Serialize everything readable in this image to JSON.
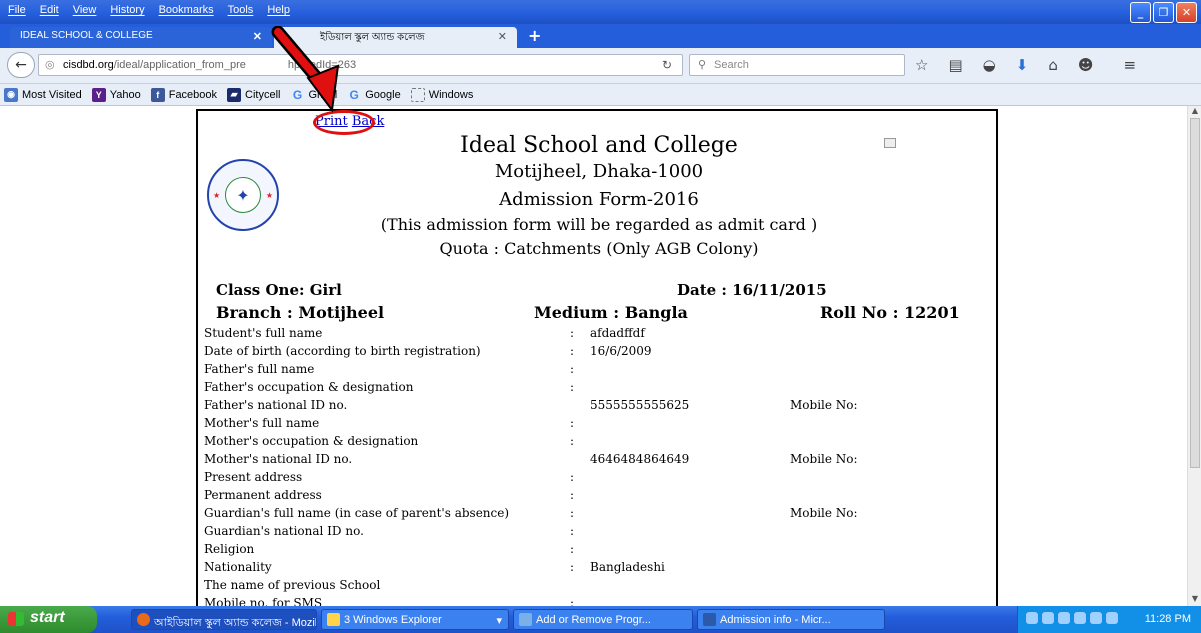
{
  "menubar": {
    "items": [
      "File",
      "Edit",
      "View",
      "History",
      "Bookmarks",
      "Tools",
      "Help"
    ]
  },
  "tabs": [
    {
      "label": "IDEAL SCHOOL & COLLEGE"
    },
    {
      "label": "ইডিয়াল স্কুল অ্যান্ড কলেজ"
    }
  ],
  "nav": {
    "url_host": "cisdbd.org",
    "url_path": "/ideal/application_from_pre",
    "url_tail": "hp?redId=263",
    "search_placeholder": "Search"
  },
  "bookmarks": [
    {
      "label": "Most Visited",
      "icon": "most-visited-icon"
    },
    {
      "label": "Yahoo",
      "icon": "yahoo-icon"
    },
    {
      "label": "Facebook",
      "icon": "facebook-icon"
    },
    {
      "label": "Citycell",
      "icon": "citycell-icon"
    },
    {
      "label": "Gmail",
      "icon": "google-icon"
    },
    {
      "label": "Google",
      "icon": "google-icon"
    },
    {
      "label": "Windows",
      "icon": "folder-icon"
    }
  ],
  "form": {
    "print_link": "Print",
    "back_link": "Back",
    "school": "Ideal School and College",
    "location": "Motijheel, Dhaka-1000",
    "form_title": "Admission Form-2016",
    "note": "(This admission form will be regarded as admit card )",
    "quota": "Quota : Catchments (Only AGB Colony)",
    "class": "Class One: Girl",
    "date": "Date : 16/11/2015",
    "branch": "Branch :  Motijheel",
    "medium": "Medium : Bangla",
    "roll": "Roll No : 12201",
    "rows": [
      {
        "label": "Student's full name",
        "value": "afdadffdf",
        "mobile": ""
      },
      {
        "label": "Date of birth (according to birth registration)",
        "value": "16/6/2009",
        "mobile": ""
      },
      {
        "label": "Father's full name",
        "value": "",
        "mobile": ""
      },
      {
        "label": "Father's occupation & designation",
        "value": "",
        "mobile": ""
      },
      {
        "label": "Father's national ID no.",
        "value": "5555555555625",
        "mobile": "Mobile No:"
      },
      {
        "label": "Mother's full name",
        "value": "",
        "mobile": ""
      },
      {
        "label": "Mother's occupation & designation",
        "value": "",
        "mobile": ""
      },
      {
        "label": "Mother's national ID no.",
        "value": "4646484864649",
        "mobile": "Mobile No:"
      },
      {
        "label": "Present address",
        "value": "",
        "mobile": ""
      },
      {
        "label": "Permanent address",
        "value": "",
        "mobile": ""
      },
      {
        "label": "Guardian's full name (in case of parent's absence)",
        "value": "",
        "mobile": "Mobile No:"
      },
      {
        "label": "Guardian's national ID no.",
        "value": "",
        "mobile": ""
      },
      {
        "label": "Religion",
        "value": "",
        "mobile": ""
      },
      {
        "label": "Nationality",
        "value": "Bangladeshi",
        "mobile": ""
      },
      {
        "label": " The name of previous School",
        "value": "",
        "mobile": ""
      },
      {
        "label": "Mobile no. for SMS",
        "value": "",
        "mobile": ""
      }
    ]
  },
  "taskbar": {
    "start": "start",
    "buttons": [
      {
        "label": "আইডিয়াল স্কুল অ্যান্ড কলেজ - Mozill..."
      },
      {
        "label": "3 Windows Explorer"
      },
      {
        "label": "Add or Remove Progr..."
      },
      {
        "label": "Admission info - Micr..."
      }
    ],
    "clock": "11:28 PM"
  },
  "colors": {
    "annotation": "#e01010",
    "link": "#0000cc",
    "xp_blue": "#245edb"
  }
}
